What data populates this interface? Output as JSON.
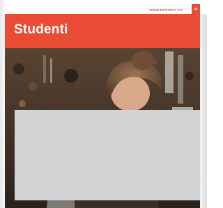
{
  "header": {
    "site_url": "WWW.PROINFO.CH",
    "page_number": "44"
  },
  "section": {
    "title": "Studenti"
  },
  "photo": {
    "subject": "student-at-workbench-photo"
  },
  "colors": {
    "accent": "#e94b35",
    "panel": "#d2d3d5",
    "photo_dark": "#3a2e26"
  }
}
